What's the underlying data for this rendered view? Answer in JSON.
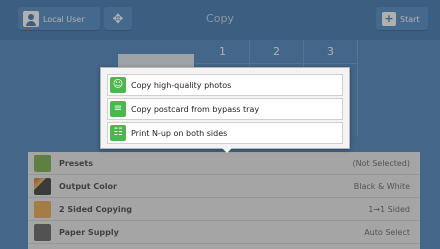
{
  "topbar": {
    "user_label": "Local User",
    "title": "Copy",
    "start_label": "Start",
    "icons": {
      "user": "user-icon",
      "tools": "tools-icon",
      "start": "start-icon"
    }
  },
  "quantity": {
    "columns": [
      "1",
      "2",
      "3"
    ]
  },
  "popup": {
    "options": [
      {
        "label": "Copy high-quality photos",
        "icon": "smiley-icon"
      },
      {
        "label": "Copy postcard from bypass tray",
        "icon": "document-icon"
      },
      {
        "label": "Print N-up on both sides",
        "icon": "book-icon"
      }
    ]
  },
  "settings": {
    "rows": [
      {
        "label": "Presets",
        "value": "(Not Selected)",
        "icon": "presets-icon",
        "color": "#6aaa3a"
      },
      {
        "label": "Output Color",
        "value": "Black & White",
        "icon": "color-icon",
        "color": "#2b2b2b"
      },
      {
        "label": "2 Sided Copying",
        "value": "1→1 Sided",
        "icon": "duplex-icon",
        "color": "#e8a23a"
      },
      {
        "label": "Paper Supply",
        "value": "Auto Select",
        "icon": "paper-tray-icon",
        "color": "#555555"
      }
    ]
  },
  "colors": {
    "topbar": "#2a6aa9",
    "content": "#3a78b8",
    "popup_icon": "#4fb64f"
  }
}
